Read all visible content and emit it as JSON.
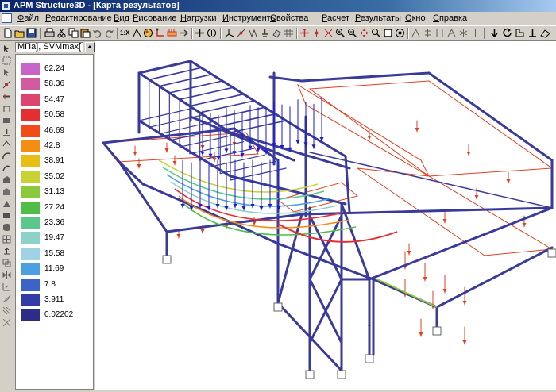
{
  "window": {
    "title": "APM Structure3D - [Карта результатов]"
  },
  "menubar": {
    "items": [
      {
        "label": "Файл",
        "underline": "Ф",
        "rest": "айл"
      },
      {
        "label": "Редактирование",
        "underline": "Р",
        "rest": "едактирование"
      },
      {
        "label": "Вид",
        "underline": "В",
        "rest": "ид"
      },
      {
        "label": "Рисование",
        "underline": "Р",
        "rest": "исование"
      },
      {
        "label": "Нагрузки",
        "underline": "Н",
        "rest": "агрузки"
      },
      {
        "label": "Инструменты",
        "underline": "И",
        "rest": "нструменты"
      },
      {
        "label": "Свойства",
        "underline": "С",
        "rest": "войства"
      },
      {
        "label": "Расчет",
        "underline": "Р",
        "rest": "асчет"
      },
      {
        "label": "Результаты",
        "underline": "Р",
        "rest": "езультаты"
      },
      {
        "label": "Окно",
        "underline": "О",
        "rest": "кно"
      },
      {
        "label": "Справка",
        "underline": "С",
        "rest": "правка"
      }
    ]
  },
  "toolbar": {
    "icons": [
      "new-icon",
      "open-icon",
      "save-icon",
      "print-icon",
      "cut-icon",
      "copy-icon",
      "paste-icon",
      "undo-icon",
      "redo-icon",
      "scale-icon",
      "snap-icon",
      "color-icon",
      "label-icon",
      "load-icon",
      "arrow-icon",
      "move-icon",
      "rotate-icon",
      "axes-icon",
      "node-icon",
      "beam-icon",
      "support-icon",
      "plate-icon",
      "grid-icon",
      "select-icon",
      "zoom-in-icon",
      "zoom-out-icon",
      "zoom-window-icon",
      "pan-icon",
      "search-icon",
      "fit-icon",
      "view-icon",
      "force-icon",
      "reaction-icon",
      "moment-icon",
      "deform-icon",
      "stress-icon",
      "mode-icon",
      "down-arrow-icon",
      "rotate-view-icon",
      "iso-view-icon",
      "side-view-icon"
    ],
    "scale_label": "1:X"
  },
  "legend": {
    "header": "МПа], SVMmax[",
    "items": [
      {
        "value": "62.24",
        "color": "#c864c8"
      },
      {
        "value": "58.36",
        "color": "#d25aa0"
      },
      {
        "value": "54.47",
        "color": "#dc466e"
      },
      {
        "value": "50.58",
        "color": "#e62d32"
      },
      {
        "value": "46.69",
        "color": "#f04b19"
      },
      {
        "value": "42.8",
        "color": "#f58c14"
      },
      {
        "value": "38.91",
        "color": "#e6be14"
      },
      {
        "value": "35.02",
        "color": "#c8d232"
      },
      {
        "value": "31.13",
        "color": "#8cc83c"
      },
      {
        "value": "27.24",
        "color": "#50be46"
      },
      {
        "value": "23.36",
        "color": "#5ac88c"
      },
      {
        "value": "19.47",
        "color": "#8cd2c8"
      },
      {
        "value": "15.58",
        "color": "#a0d2e6"
      },
      {
        "value": "11.69",
        "color": "#4ba0e1"
      },
      {
        "value": "7.8",
        "color": "#3c64c8"
      },
      {
        "value": "3.911",
        "color": "#323ca5"
      },
      {
        "value": "0.02202",
        "color": "#2d2d87"
      }
    ]
  },
  "colors": {
    "frame_member": "#3a3a9a",
    "load_arrow": "#1a1ad0",
    "distributed_load": "#e04020",
    "background": "#ffffff"
  }
}
